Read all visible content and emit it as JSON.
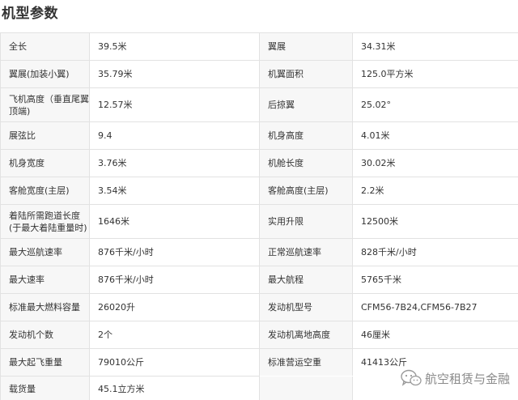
{
  "title": "机型参数",
  "rows": [
    {
      "l1": "全长",
      "v1": "39.5米",
      "l2": "翼展",
      "v2": "34.31米"
    },
    {
      "l1": "翼展(加装小翼)",
      "v1": "35.79米",
      "l2": "机翼面积",
      "v2": "125.0平方米"
    },
    {
      "l1": "飞机高度（垂直尾翼顶端)",
      "v1": "12.57米",
      "l2": "后掠翼",
      "v2": "25.02°"
    },
    {
      "l1": "展弦比",
      "v1": "9.4",
      "l2": "机身高度",
      "v2": "4.01米"
    },
    {
      "l1": "机身宽度",
      "v1": "3.76米",
      "l2": "机舱长度",
      "v2": "30.02米"
    },
    {
      "l1": "客舱宽度(主层)",
      "v1": "3.54米",
      "l2": "客舱高度(主层)",
      "v2": "2.2米"
    },
    {
      "l1": "着陆所需跑道长度(于最大着陆重量时)",
      "v1": "1646米",
      "l2": "实用升限",
      "v2": "12500米"
    },
    {
      "l1": "最大巡航速率",
      "v1": "876千米/小时",
      "l2": "正常巡航速率",
      "v2": "828千米/小时"
    },
    {
      "l1": "最大速率",
      "v1": "876千米/小时",
      "l2": "最大航程",
      "v2": "5765千米"
    },
    {
      "l1": "标准最大燃料容量",
      "v1": "26020升",
      "l2": "发动机型号",
      "v2": "CFM56-7B24,CFM56-7B27"
    },
    {
      "l1": "发动机个数",
      "v1": "2个",
      "l2": "发动机离地高度",
      "v2": "46厘米"
    },
    {
      "l1": "最大起飞重量",
      "v1": "79010公斤",
      "l2": "标准营运空重",
      "v2": "41413公斤"
    },
    {
      "l1": "载货量",
      "v1": "45.1立方米",
      "l2": "",
      "v2": ""
    }
  ],
  "watermark": {
    "text": "航空租赁与金融",
    "icon": "wechat-icon"
  }
}
